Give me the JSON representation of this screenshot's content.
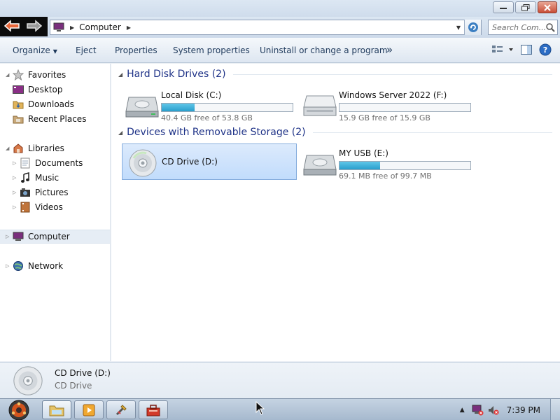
{
  "window": {
    "buttons": {
      "minimize": "minimize-icon",
      "restore": "restore-icon",
      "close": "close-icon"
    }
  },
  "address": {
    "crumbs": [
      "Computer"
    ],
    "search_placeholder": "Search Com..."
  },
  "toolbar": {
    "organize": "Organize",
    "eject": "Eject",
    "properties": "Properties",
    "system_properties": "System properties",
    "uninstall": "Uninstall or change a program",
    "more": "»"
  },
  "sidebar": {
    "favorites": {
      "label": "Favorites",
      "items": [
        "Desktop",
        "Downloads",
        "Recent Places"
      ]
    },
    "libraries": {
      "label": "Libraries",
      "items": [
        "Documents",
        "Music",
        "Pictures",
        "Videos"
      ]
    },
    "computer": "Computer",
    "network": "Network"
  },
  "groups": [
    {
      "title": "Hard Disk Drives (2)",
      "items": [
        {
          "name": "Local Disk (C:)",
          "free": "40.4 GB free of 53.8 GB",
          "used_fraction": 0.25,
          "icon": "hard-disk-icon"
        },
        {
          "name": "Windows Server 2022 (F:)",
          "free": "15.9 GB free of 15.9 GB",
          "used_fraction": 0.0,
          "icon": "hard-disk-icon"
        }
      ]
    },
    {
      "title": "Devices with Removable Storage (2)",
      "items": [
        {
          "name": "CD Drive (D:)",
          "icon": "cd-drive-icon",
          "selected": true
        },
        {
          "name": "MY USB (E:)",
          "free": "69.1 MB free of 99.7 MB",
          "used_fraction": 0.31,
          "icon": "usb-drive-icon"
        }
      ]
    }
  ],
  "details": {
    "title": "CD Drive (D:)",
    "subtitle": "CD Drive"
  },
  "taskbar": {
    "clock": "7:39 PM"
  },
  "colors": {
    "accent": "#1e3287",
    "selection": "#c1dcfc",
    "progress": "#2a9ecc"
  }
}
